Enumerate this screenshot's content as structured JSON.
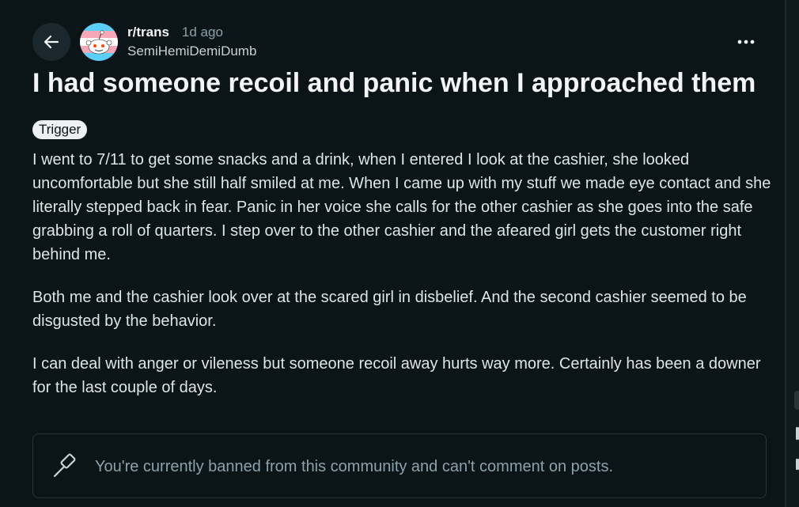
{
  "post": {
    "subreddit": "r/trans",
    "time_ago": "1d ago",
    "author": "SemiHemiDemiDumb",
    "title": "I had someone recoil and panic when I approached them",
    "flair": "Trigger",
    "paragraphs": [
      "I went to 7/11 to get some snacks and a drink, when I entered I look at the cashier, she looked uncomfortable but she still half smiled at me. When I came up with my stuff we made eye contact and she literally stepped back in fear. Panic in her voice she calls for the other cashier as she goes into the safe grabbing a roll of quarters. I step over to the other cashier and the afeared girl gets the customer right behind me.",
      "Both me and the cashier look over at the scared girl in disbelief. And the second cashier seemed to be disgusted by the behavior.",
      "I can deal with anger or vileness but someone recoil away hurts way more. Certainly has been a downer for the last couple of days."
    ]
  },
  "comment_box": {
    "banned_message": "You're currently banned from this community and can't comment on posts."
  },
  "icons": {
    "back": "arrow-left-icon",
    "more": "overflow-menu-icon",
    "banned": "gavel-icon",
    "avatar": "snoo-trans-flag-avatar"
  },
  "colors": {
    "background": "#0b1416",
    "text_primary": "#f2f4f5",
    "text_secondary": "#8ba2ad",
    "flair_bg": "#eef1f3",
    "trans_blue": "#5bcefa",
    "trans_pink": "#f5a9b8"
  }
}
